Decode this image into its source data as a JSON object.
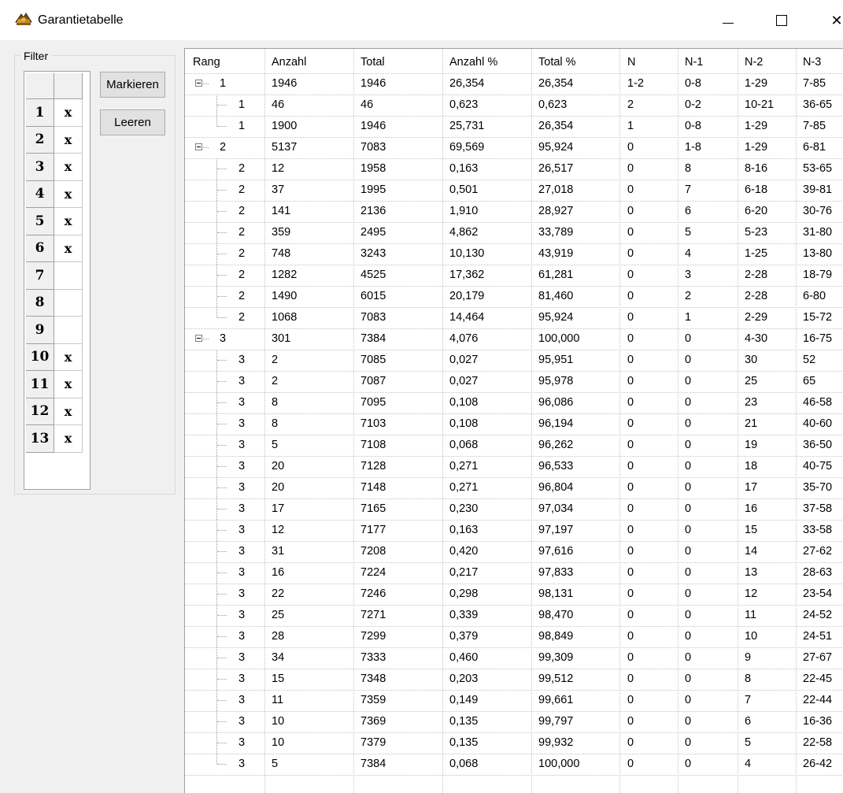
{
  "window": {
    "title": "Garantietabelle",
    "minimize_glyph": "",
    "close_glyph": "✕",
    "icon": "app-icon"
  },
  "filter": {
    "legend": "Filter",
    "rows": [
      {
        "num": "1",
        "mark": "x"
      },
      {
        "num": "2",
        "mark": "x"
      },
      {
        "num": "3",
        "mark": "x"
      },
      {
        "num": "4",
        "mark": "x"
      },
      {
        "num": "5",
        "mark": "x"
      },
      {
        "num": "6",
        "mark": "x"
      },
      {
        "num": "7",
        "mark": ""
      },
      {
        "num": "8",
        "mark": ""
      },
      {
        "num": "9",
        "mark": ""
      },
      {
        "num": "10",
        "mark": "x"
      },
      {
        "num": "11",
        "mark": "x"
      },
      {
        "num": "12",
        "mark": "x"
      },
      {
        "num": "13",
        "mark": "x"
      }
    ],
    "mark_button": "Markieren",
    "clear_button": "Leeren"
  },
  "table": {
    "columns": [
      "Rang",
      "Anzahl",
      "Total",
      "Anzahl %",
      "Total %",
      "N",
      "N-1",
      "N-2",
      "N-3"
    ],
    "rows": [
      {
        "level": 0,
        "cells": [
          "1",
          "1946",
          "1946",
          "26,354",
          "26,354",
          "1-2",
          "0-8",
          "1-29",
          "7-85"
        ]
      },
      {
        "level": 1,
        "cells": [
          "1",
          "46",
          "46",
          "0,623",
          "0,623",
          "2",
          "0-2",
          "10-21",
          "36-65"
        ]
      },
      {
        "level": 1,
        "last": true,
        "cells": [
          "1",
          "1900",
          "1946",
          "25,731",
          "26,354",
          "1",
          "0-8",
          "1-29",
          "7-85"
        ]
      },
      {
        "level": 0,
        "cells": [
          "2",
          "5137",
          "7083",
          "69,569",
          "95,924",
          "0",
          "1-8",
          "1-29",
          "6-81"
        ]
      },
      {
        "level": 1,
        "cells": [
          "2",
          "12",
          "1958",
          "0,163",
          "26,517",
          "0",
          "8",
          "8-16",
          "53-65"
        ]
      },
      {
        "level": 1,
        "cells": [
          "2",
          "37",
          "1995",
          "0,501",
          "27,018",
          "0",
          "7",
          "6-18",
          "39-81"
        ]
      },
      {
        "level": 1,
        "cells": [
          "2",
          "141",
          "2136",
          "1,910",
          "28,927",
          "0",
          "6",
          "6-20",
          "30-76"
        ]
      },
      {
        "level": 1,
        "cells": [
          "2",
          "359",
          "2495",
          "4,862",
          "33,789",
          "0",
          "5",
          "5-23",
          "31-80"
        ]
      },
      {
        "level": 1,
        "cells": [
          "2",
          "748",
          "3243",
          "10,130",
          "43,919",
          "0",
          "4",
          "1-25",
          "13-80"
        ]
      },
      {
        "level": 1,
        "cells": [
          "2",
          "1282",
          "4525",
          "17,362",
          "61,281",
          "0",
          "3",
          "2-28",
          "18-79"
        ]
      },
      {
        "level": 1,
        "cells": [
          "2",
          "1490",
          "6015",
          "20,179",
          "81,460",
          "0",
          "2",
          "2-28",
          "6-80"
        ]
      },
      {
        "level": 1,
        "last": true,
        "cells": [
          "2",
          "1068",
          "7083",
          "14,464",
          "95,924",
          "0",
          "1",
          "2-29",
          "15-72"
        ]
      },
      {
        "level": 0,
        "cells": [
          "3",
          "301",
          "7384",
          "4,076",
          "100,000",
          "0",
          "0",
          "4-30",
          "16-75"
        ]
      },
      {
        "level": 1,
        "cells": [
          "3",
          "2",
          "7085",
          "0,027",
          "95,951",
          "0",
          "0",
          "30",
          "52"
        ]
      },
      {
        "level": 1,
        "cells": [
          "3",
          "2",
          "7087",
          "0,027",
          "95,978",
          "0",
          "0",
          "25",
          "65"
        ]
      },
      {
        "level": 1,
        "cells": [
          "3",
          "8",
          "7095",
          "0,108",
          "96,086",
          "0",
          "0",
          "23",
          "46-58"
        ]
      },
      {
        "level": 1,
        "cells": [
          "3",
          "8",
          "7103",
          "0,108",
          "96,194",
          "0",
          "0",
          "21",
          "40-60"
        ]
      },
      {
        "level": 1,
        "cells": [
          "3",
          "5",
          "7108",
          "0,068",
          "96,262",
          "0",
          "0",
          "19",
          "36-50"
        ]
      },
      {
        "level": 1,
        "cells": [
          "3",
          "20",
          "7128",
          "0,271",
          "96,533",
          "0",
          "0",
          "18",
          "40-75"
        ]
      },
      {
        "level": 1,
        "cells": [
          "3",
          "20",
          "7148",
          "0,271",
          "96,804",
          "0",
          "0",
          "17",
          "35-70"
        ]
      },
      {
        "level": 1,
        "cells": [
          "3",
          "17",
          "7165",
          "0,230",
          "97,034",
          "0",
          "0",
          "16",
          "37-58"
        ]
      },
      {
        "level": 1,
        "cells": [
          "3",
          "12",
          "7177",
          "0,163",
          "97,197",
          "0",
          "0",
          "15",
          "33-58"
        ]
      },
      {
        "level": 1,
        "cells": [
          "3",
          "31",
          "7208",
          "0,420",
          "97,616",
          "0",
          "0",
          "14",
          "27-62"
        ]
      },
      {
        "level": 1,
        "cells": [
          "3",
          "16",
          "7224",
          "0,217",
          "97,833",
          "0",
          "0",
          "13",
          "28-63"
        ]
      },
      {
        "level": 1,
        "cells": [
          "3",
          "22",
          "7246",
          "0,298",
          "98,131",
          "0",
          "0",
          "12",
          "23-54"
        ]
      },
      {
        "level": 1,
        "cells": [
          "3",
          "25",
          "7271",
          "0,339",
          "98,470",
          "0",
          "0",
          "11",
          "24-52"
        ]
      },
      {
        "level": 1,
        "cells": [
          "3",
          "28",
          "7299",
          "0,379",
          "98,849",
          "0",
          "0",
          "10",
          "24-51"
        ]
      },
      {
        "level": 1,
        "cells": [
          "3",
          "34",
          "7333",
          "0,460",
          "99,309",
          "0",
          "0",
          "9",
          "27-67"
        ]
      },
      {
        "level": 1,
        "cells": [
          "3",
          "15",
          "7348",
          "0,203",
          "99,512",
          "0",
          "0",
          "8",
          "22-45"
        ]
      },
      {
        "level": 1,
        "cells": [
          "3",
          "11",
          "7359",
          "0,149",
          "99,661",
          "0",
          "0",
          "7",
          "22-44"
        ]
      },
      {
        "level": 1,
        "cells": [
          "3",
          "10",
          "7369",
          "0,135",
          "99,797",
          "0",
          "0",
          "6",
          "16-36"
        ]
      },
      {
        "level": 1,
        "cells": [
          "3",
          "10",
          "7379",
          "0,135",
          "99,932",
          "0",
          "0",
          "5",
          "22-58"
        ]
      },
      {
        "level": 1,
        "last": true,
        "cells": [
          "3",
          "5",
          "7384",
          "0,068",
          "100,000",
          "0",
          "0",
          "4",
          "26-42"
        ]
      }
    ]
  }
}
